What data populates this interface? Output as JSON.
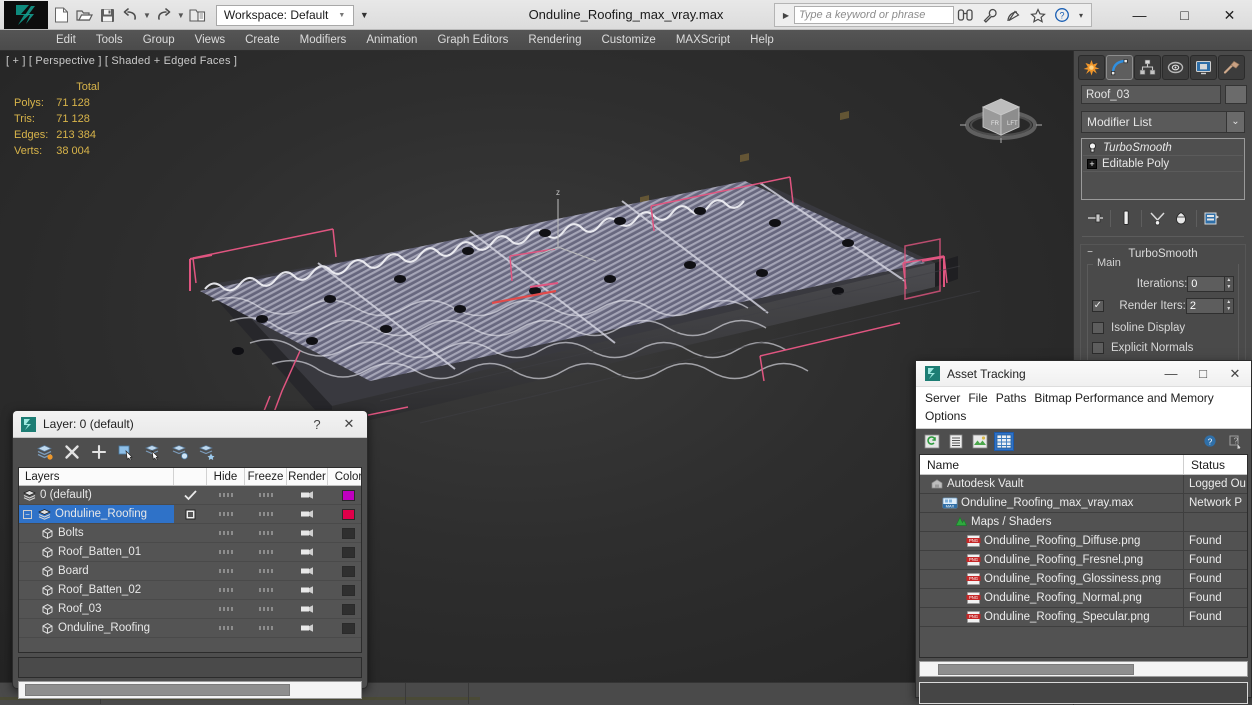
{
  "app": {
    "title": "Onduline_Roofing_max_vray.max",
    "workspace_label": "Workspace: Default",
    "logo_name": "3dsmax-logo"
  },
  "quick_access": [
    {
      "name": "new-file-icon",
      "label": "New"
    },
    {
      "name": "open-file-icon",
      "label": "Open"
    },
    {
      "name": "save-file-icon",
      "label": "Save"
    },
    {
      "name": "undo-icon",
      "label": "Undo"
    },
    {
      "name": "redo-icon",
      "label": "Redo"
    },
    {
      "name": "project-folder-icon",
      "label": "Set Project Folder"
    }
  ],
  "search": {
    "placeholder": "Type a keyword or phrase",
    "icons": [
      "binoculars-icon",
      "wrench-icon",
      "satellite-dish-icon",
      "star-icon",
      "help-icon"
    ]
  },
  "window_controls": {
    "minimize": "—",
    "maximize": "□",
    "close": "✕"
  },
  "menu": [
    "Edit",
    "Tools",
    "Group",
    "Views",
    "Create",
    "Modifiers",
    "Animation",
    "Graph Editors",
    "Rendering",
    "Customize",
    "MAXScript",
    "Help"
  ],
  "viewport": {
    "label": "[ + ] [ Perspective ] [ Shaded + Edged Faces ]",
    "stats": {
      "header": "Total",
      "rows": [
        {
          "label": "Polys:",
          "value": "71 128"
        },
        {
          "label": "Tris:",
          "value": "71 128"
        },
        {
          "label": "Edges:",
          "value": "213 384"
        },
        {
          "label": "Verts:",
          "value": "38 004"
        }
      ]
    },
    "viewcube_name": "view-cube"
  },
  "command_panel": {
    "tabs": [
      {
        "name": "tab-create",
        "label": "Create",
        "active": false
      },
      {
        "name": "tab-modify",
        "label": "Modify",
        "active": true
      },
      {
        "name": "tab-hierarchy",
        "label": "Hierarchy",
        "active": false
      },
      {
        "name": "tab-motion",
        "label": "Motion",
        "active": false
      },
      {
        "name": "tab-display",
        "label": "Display",
        "active": false
      },
      {
        "name": "tab-utilities",
        "label": "Utilities",
        "active": false
      }
    ],
    "object_name": "Roof_03",
    "modifier_list_label": "Modifier List",
    "stack": [
      {
        "name": "TurboSmooth",
        "type": "modifier"
      },
      {
        "name": "Editable Poly",
        "type": "base"
      }
    ],
    "stack_buttons": [
      "pin-stack-icon",
      "show-end-result-icon",
      "make-unique-icon",
      "remove-modifier-icon",
      "configure-sets-icon"
    ],
    "rollout": {
      "title": "TurboSmooth",
      "group_label": "Main",
      "iterations_label": "Iterations:",
      "iterations_value": "0",
      "render_iters_label": "Render Iters:",
      "render_iters_value": "2",
      "render_iters_checked": true,
      "isoline_label": "Isoline Display",
      "isoline_checked": false,
      "explicit_label": "Explicit Normals",
      "explicit_checked": false
    }
  },
  "layer_dialog": {
    "title": "Layer: 0 (default)",
    "help_btn": "?",
    "close_btn": "✕",
    "toolbar": [
      "new-layer-icon",
      "delete-layer-icon",
      "add-layer-icon",
      "select-objects-icon",
      "select-highlighted-icon",
      "add-selected-icon",
      "set-current-icon"
    ],
    "columns": [
      "Layers",
      "Hide",
      "Freeze",
      "Render",
      "Color"
    ],
    "rows": [
      {
        "name": "0 (default)",
        "indent": 0,
        "icon": "layer-icon",
        "current": true,
        "selected": false,
        "color": "#c000c0",
        "expander": false
      },
      {
        "name": "Onduline_Roofing",
        "indent": 0,
        "icon": "layer-icon",
        "current": false,
        "selected": true,
        "color": "#e0004a",
        "expander": true
      },
      {
        "name": "Bolts",
        "indent": 1,
        "icon": "object-icon",
        "current": false,
        "selected": false,
        "color": "#2f2f2f",
        "expander": false
      },
      {
        "name": "Roof_Batten_01",
        "indent": 1,
        "icon": "object-icon",
        "current": false,
        "selected": false,
        "color": "#2f2f2f",
        "expander": false
      },
      {
        "name": "Board",
        "indent": 1,
        "icon": "object-icon",
        "current": false,
        "selected": false,
        "color": "#2f2f2f",
        "expander": false
      },
      {
        "name": "Roof_Batten_02",
        "indent": 1,
        "icon": "object-icon",
        "current": false,
        "selected": false,
        "color": "#2f2f2f",
        "expander": false
      },
      {
        "name": "Roof_03",
        "indent": 1,
        "icon": "object-icon",
        "current": false,
        "selected": false,
        "color": "#2f2f2f",
        "expander": false
      },
      {
        "name": "Onduline_Roofing",
        "indent": 1,
        "icon": "object-icon",
        "current": false,
        "selected": false,
        "color": "#2f2f2f",
        "expander": false
      }
    ]
  },
  "asset_tracking": {
    "title": "Asset Tracking",
    "window_controls": {
      "minimize": "—",
      "maximize": "□",
      "close": "✕"
    },
    "menus": [
      "Server",
      "File",
      "Paths",
      "Bitmap Performance and Memory",
      "Options"
    ],
    "toolbar": [
      "refresh-icon",
      "list-view-icon",
      "thumbnail-view-icon",
      "grid-view-icon"
    ],
    "help_icons": [
      "help-icon",
      "whats-this-icon"
    ],
    "columns": [
      "Name",
      "Status"
    ],
    "rows": [
      {
        "name": "Autodesk Vault",
        "status": "Logged Ou",
        "indent": 0,
        "icon": "vault-icon"
      },
      {
        "name": "Onduline_Roofing_max_vray.max",
        "status": "Network P",
        "indent": 1,
        "icon": "max-file-icon"
      },
      {
        "name": "Maps / Shaders",
        "status": "",
        "indent": 2,
        "icon": "maps-shaders-icon"
      },
      {
        "name": "Onduline_Roofing_Diffuse.png",
        "status": "Found",
        "indent": 3,
        "icon": "png-icon"
      },
      {
        "name": "Onduline_Roofing_Fresnel.png",
        "status": "Found",
        "indent": 3,
        "icon": "png-icon"
      },
      {
        "name": "Onduline_Roofing_Glossiness.png",
        "status": "Found",
        "indent": 3,
        "icon": "png-icon"
      },
      {
        "name": "Onduline_Roofing_Normal.png",
        "status": "Found",
        "indent": 3,
        "icon": "png-icon"
      },
      {
        "name": "Onduline_Roofing_Specular.png",
        "status": "Found",
        "indent": 3,
        "icon": "png-icon"
      }
    ]
  },
  "colors": {
    "accent_blue": "#2f72c8",
    "stat_yellow": "#d8b44a",
    "gizmo_pink": "#e05580",
    "panel_gray": "#4a4a4a"
  }
}
